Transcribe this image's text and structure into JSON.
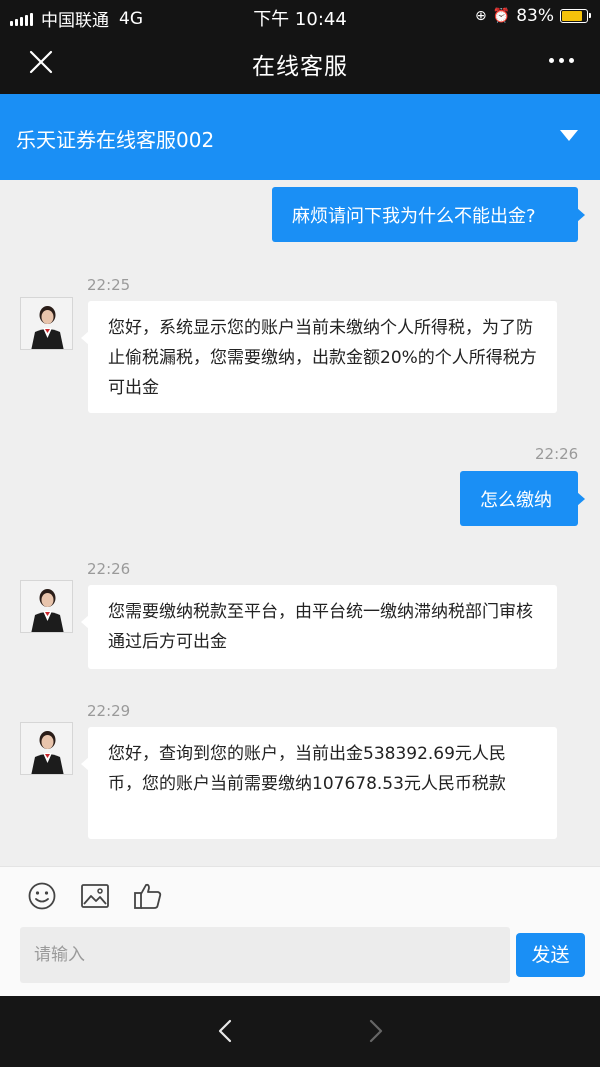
{
  "status_bar": {
    "carrier": "中国联通",
    "network": "4G",
    "time": "下午 10:44",
    "battery": "83%",
    "battery_level": 0.83,
    "battery_color": "#f5c20b"
  },
  "nav": {
    "title": "在线客服",
    "close_icon": "close-icon",
    "more_icon": "more-icon"
  },
  "service": {
    "name": "乐天证券在线客服002",
    "accent": "#1a8ff5"
  },
  "messages": [
    {
      "from": "user",
      "text": "麻烦请问下我为什么不能出金?"
    },
    {
      "from": "agent",
      "time": "22:25",
      "text": "您好，系统显示您的账户当前未缴纳个人所得税，为了防止偷税漏税，您需要缴纳，出款金额20%的个人所得税方可出金"
    },
    {
      "from": "user",
      "time": "22:26",
      "text": "怎么缴纳"
    },
    {
      "from": "agent",
      "time": "22:26",
      "text": "您需要缴纳税款至平台，由平台统一缴纳滞纳税部门审核通过后方可出金"
    },
    {
      "from": "agent",
      "time": "22:29",
      "text": "您好，查询到您的账户，当前出金538392.69元人民币，您的账户当前需要缴纳107678.53元人民币税款"
    }
  ],
  "composer": {
    "placeholder": "请输入",
    "send_label": "发送",
    "tools": [
      "emoji-icon",
      "image-icon",
      "thumbs-up-icon"
    ]
  },
  "toolbar": {
    "back_icon": "back-arrow-icon",
    "forward_icon": "forward-arrow-icon"
  }
}
